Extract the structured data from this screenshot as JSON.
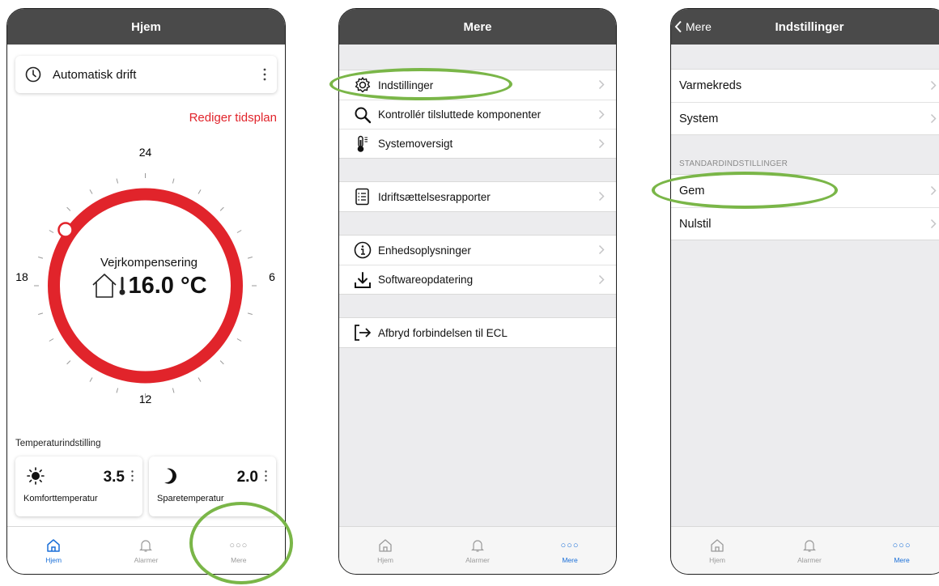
{
  "screen1": {
    "title": "Hjem",
    "mode_label": "Automatisk drift",
    "edit_schedule": "Rediger tidsplan",
    "dial": {
      "labels": [
        "24",
        "6",
        "12",
        "18"
      ],
      "mode": "Vejrkompensering",
      "temperature": "16.0 °C",
      "accent_color": "#e1242b"
    },
    "section_label": "Temperaturindstilling",
    "comfort": {
      "value": "3.5",
      "label": "Komforttemperatur"
    },
    "saving": {
      "value": "2.0",
      "label": "Sparetemperatur"
    },
    "tabs": [
      {
        "label": "Hjem",
        "icon": "home-icon",
        "active": true
      },
      {
        "label": "Alarmer",
        "icon": "bell-icon",
        "active": false
      },
      {
        "label": "Mere",
        "icon": "more-dots-icon",
        "active": false
      }
    ]
  },
  "screen2": {
    "title": "Mere",
    "groups": [
      [
        {
          "label": "Indstillinger",
          "icon": "gear-icon"
        },
        {
          "label": "Kontrollér tilsluttede komponenter",
          "icon": "magnifier-icon"
        },
        {
          "label": "Systemoversigt",
          "icon": "thermometer-icon"
        }
      ],
      [
        {
          "label": "Idriftsættelsesrapporter",
          "icon": "report-icon"
        }
      ],
      [
        {
          "label": "Enhedsoplysninger",
          "icon": "info-icon"
        },
        {
          "label": "Softwareopdatering",
          "icon": "download-icon"
        }
      ],
      [
        {
          "label": "Afbryd forbindelsen til ECL",
          "icon": "disconnect-icon"
        }
      ]
    ],
    "tabs": [
      {
        "label": "Hjem",
        "icon": "home-icon",
        "active": false
      },
      {
        "label": "Alarmer",
        "icon": "bell-icon",
        "active": false
      },
      {
        "label": "Mere",
        "icon": "more-dots-icon",
        "active": true
      }
    ]
  },
  "screen3": {
    "back_label": "Mere",
    "title": "Indstillinger",
    "group1": [
      "Varmekreds",
      "System"
    ],
    "section_header": "STANDARDINDSTILLINGER",
    "group2": [
      "Gem",
      "Nulstil"
    ],
    "tabs": [
      {
        "label": "Hjem",
        "icon": "home-icon",
        "active": false
      },
      {
        "label": "Alarmer",
        "icon": "bell-icon",
        "active": false
      },
      {
        "label": "Mere",
        "icon": "more-dots-icon",
        "active": true
      }
    ]
  },
  "colors": {
    "header": "#4a4a4a",
    "active_tab": "#1a6fd8",
    "highlight": "#7ab648",
    "dial": "#e1242b"
  }
}
